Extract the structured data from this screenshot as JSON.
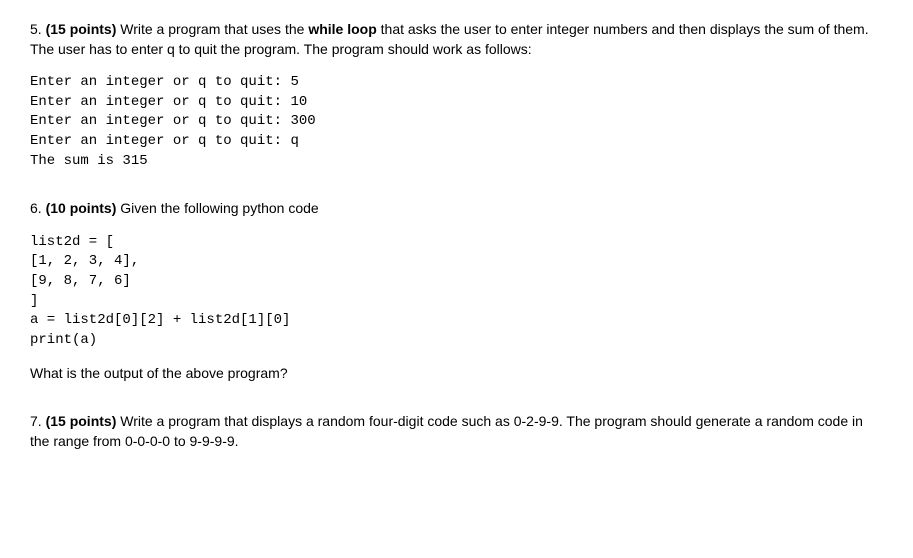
{
  "q5": {
    "number": "5.",
    "points": "(15 points)",
    "text_part1": " Write a program that uses the ",
    "bold_phrase": "while loop",
    "text_part2": " that asks the user to enter integer numbers and then displays the sum of them. The user has to enter q to quit the program. The program should work as follows:",
    "code": "Enter an integer or q to quit: 5\nEnter an integer or q to quit: 10\nEnter an integer or q to quit: 300\nEnter an integer or q to quit: q\nThe sum is 315"
  },
  "q6": {
    "number": "6.",
    "points": "(10 points)",
    "text_part1": " Given the following python code",
    "code": "list2d = [\n[1, 2, 3, 4],\n[9, 8, 7, 6]\n]\na = list2d[0][2] + list2d[1][0]\nprint(a)",
    "post_question": "What is the output of the above program?"
  },
  "q7": {
    "number": "7.",
    "points": "(15 points)",
    "text_part1": " Write a program that displays a random four-digit code such as 0-2-9-9. The program should generate a random code in the range from 0-0-0-0 to 9-9-9-9."
  }
}
